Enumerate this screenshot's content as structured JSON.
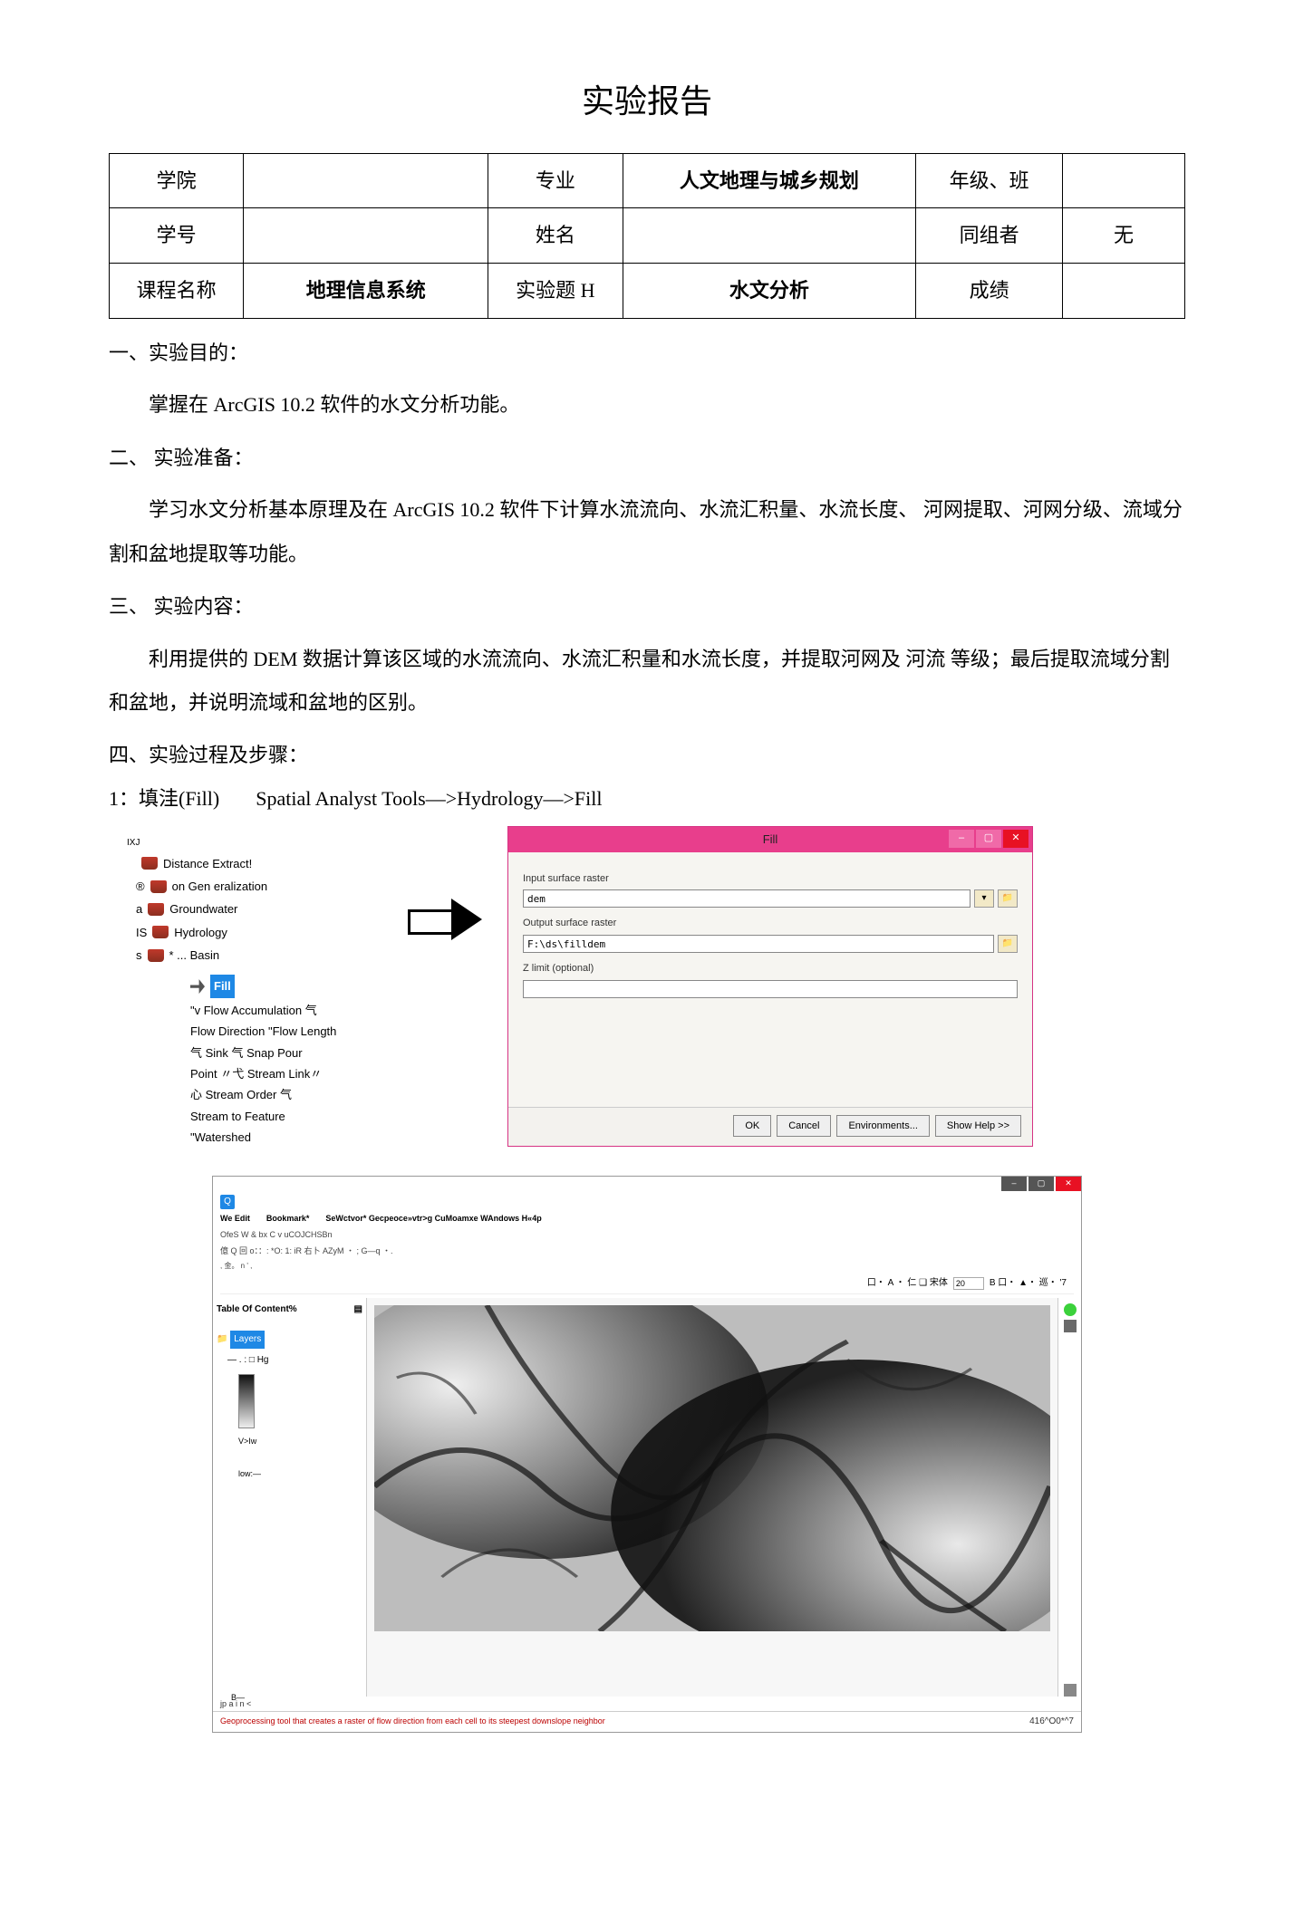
{
  "title": "实验报告",
  "table": {
    "c_college": "学院",
    "v_college": "",
    "c_major": "专业",
    "v_major": "人文地理与城乡规划",
    "c_grade": "年级、班",
    "v_grade": "",
    "c_sid": "学号",
    "v_sid": "",
    "c_name": "姓名",
    "v_name": "",
    "c_group": "同组者",
    "v_group": "无",
    "c_course": "课程名称",
    "v_course": "地理信息系统",
    "c_topic": "实验题 H",
    "v_topic": "水文分析",
    "c_score": "成绩",
    "v_score": ""
  },
  "sections": {
    "s1_head": "一、实验目的：",
    "s1_body": "掌握在 ArcGIS 10.2 软件的水文分析功能。",
    "s2_head": "二、 实验准备：",
    "s2_body": "学习水文分析基本原理及在 ArcGIS 10.2 软件下计算水流流向、水流汇积量、水流长度、 河网提取、河网分级、流域分割和盆地提取等功能。",
    "s3_head": "三、 实验内容：",
    "s3_body": "利用提供的 DEM 数据计算该区域的水流流向、水流汇积量和水流长度，并提取河网及 河流 等级；最后提取流域分割和盆地，并说明流域和盆地的区别。",
    "s4_head": "四、实验过程及步骤：",
    "step1_label": "1：填洼(Fill)",
    "step1_tool": "Spatial Analyst Tools—>Hydrology—>Fill"
  },
  "tree": {
    "head": "IXJ",
    "items": [
      "Distance Extract!",
      "on Gen eralization",
      "Groundwater",
      "Hydrology",
      "* ... Basin"
    ],
    "mark0": "",
    "mark1": "®",
    "mark2": "a",
    "mark3": "IS",
    "mark4": "s",
    "fill": "Fill",
    "sub": [
      "\"v Flow Accumulation 气",
      "Flow Direction \"Flow Length",
      "气 Sink 气 Snap Pour",
      "Point 〃弋 Stream Link〃",
      "心 Stream Order 气",
      "Stream to Feature",
      "\"Watershed"
    ]
  },
  "fillDialog": {
    "title": "Fill",
    "lbl_input": "Input surface raster",
    "val_input": "dem",
    "lbl_output": "Output surface raster",
    "val_output": "F:\\ds\\filldem",
    "lbl_zlimit": "Z limit (optional)",
    "val_zlimit": "",
    "btn_ok": "OK",
    "btn_cancel": "Cancel",
    "btn_env": "Environments...",
    "btn_help": "Show Help >>"
  },
  "arcmap": {
    "icon": "Q",
    "menu": [
      "We Edit",
      "Bookmark*",
      "SeWctvor* Gecpeoce»vtr>g CuMoamxe WAndows H«4p"
    ],
    "line2": "OfeS W & bx C                                v uCOJCHSBn",
    "line3": "億 Q 回 o：：:            *O:       1: iR 右卜 AZyM ・ ; G—q ・.",
    "line4": "                     ,          金。              n ' ,",
    "toc_title": "Table Of Content%",
    "toc_layers": "Layers",
    "toc_hg": "― . :  □  Hg",
    "toc_high": "V>Iw",
    "toc_low": "low:—",
    "draw_left": "口・ A ・ 仁 ❑ 宋体",
    "draw_size": "20",
    "draw_right": "B    口・ ▲・ 巡・ '7",
    "b_label": "B—",
    "pain": "jp a i n <",
    "status_left": "Geoprocessing tool that creates a raster of flow direction from each cell to its steepest downslope neighbor",
    "status_right": "416^O0*^7"
  }
}
